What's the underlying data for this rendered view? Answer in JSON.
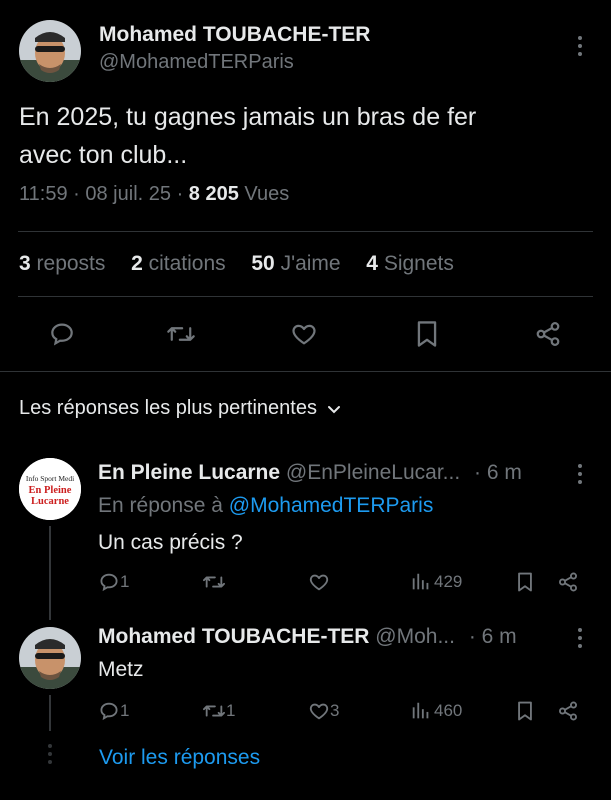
{
  "main_post": {
    "author_name": "Mohamed TOUBACHE-TER",
    "author_handle": "@MohamedTERParis",
    "text_line1": "En 2025, tu gagnes jamais un bras de fer",
    "text_line2": "avec ton club...",
    "time": "11:59",
    "sep1": "·",
    "date": "08 juil. 25",
    "sep2": "·",
    "views_count": "8 205",
    "views_label": "Vues",
    "stats": {
      "reposts_count": "3",
      "reposts_label": "reposts",
      "quotes_count": "2",
      "quotes_label": "citations",
      "likes_count": "50",
      "likes_label": "J'aime",
      "bookmarks_count": "4",
      "bookmarks_label": "Signets"
    }
  },
  "replies_header": {
    "label": "Les réponses les plus pertinentes"
  },
  "replies": [
    {
      "avatar_text_line1": "Info Sport Medi",
      "avatar_text_line2": "En Pleine",
      "avatar_text_line3": "Lucarne",
      "author_name": "En Pleine Lucarne",
      "author_handle": "@EnPleineLucar...",
      "time": "· 6 m",
      "reply_to_label": "En réponse à",
      "reply_to_handle": "@MohamedTERParis",
      "text": "Un cas précis ?",
      "replies_count": "1",
      "reposts_count": "",
      "likes_count": "",
      "views_count": "429"
    },
    {
      "author_name": "Mohamed TOUBACHE-TER",
      "author_handle": "@Moh...",
      "time": "· 6 m",
      "text": "Metz",
      "replies_count": "1",
      "reposts_count": "1",
      "likes_count": "3",
      "views_count": "460"
    }
  ],
  "show_replies_label": "Voir les réponses",
  "colors": {
    "background": "#000000",
    "text": "#e7e9ea",
    "muted": "#71767b",
    "link": "#1d9bf0",
    "separator": "#2f3336",
    "brand_red": "#cc1f1f"
  },
  "icons": {
    "reply": "speech-bubble-icon",
    "repost": "repost-arrows-icon",
    "like": "heart-icon",
    "bookmark": "bookmark-icon",
    "share": "share-nodes-icon",
    "views": "bar-chart-icon",
    "more": "vertical-dots-icon",
    "chevron": "chevron-down-icon"
  }
}
